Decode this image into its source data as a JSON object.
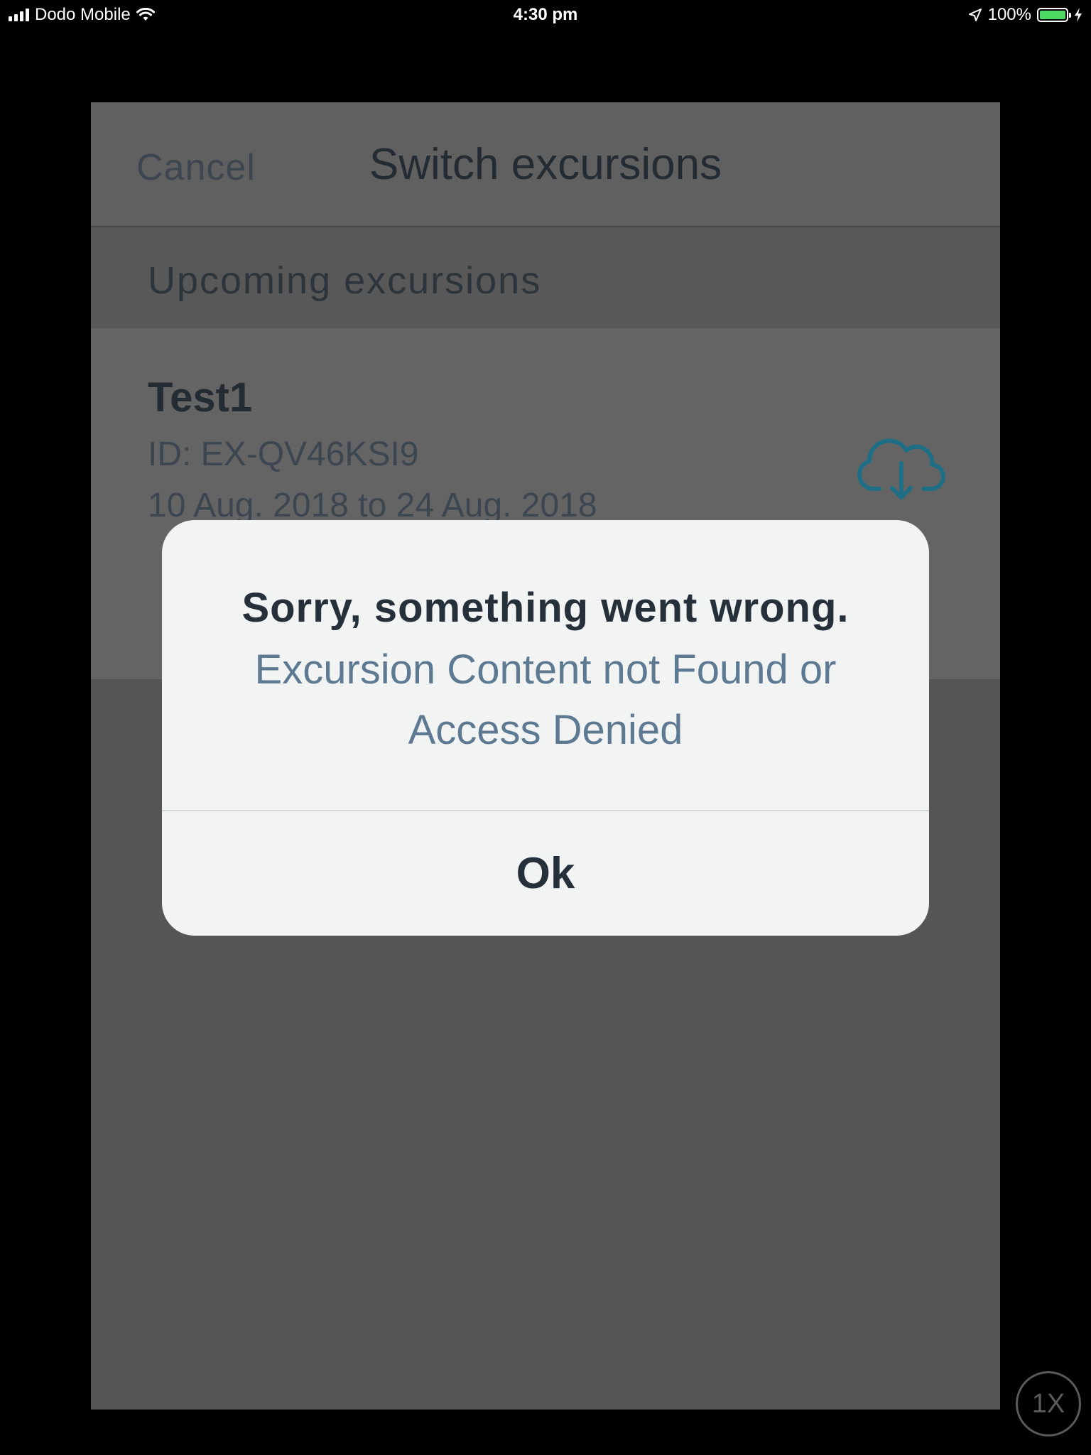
{
  "status_bar": {
    "carrier": "Dodo Mobile",
    "time": "4:30 pm",
    "battery": "100%",
    "battery_level": 1.0,
    "icons": [
      "signal-icon",
      "wifi-icon",
      "location-arrow-icon",
      "battery-icon",
      "charging-bolt-icon"
    ]
  },
  "nav": {
    "cancel_label": "Cancel",
    "title": "Switch excursions"
  },
  "section": {
    "header": "Upcoming excursions"
  },
  "excursion": {
    "name": "Test1",
    "id": "ID: EX-QV46KSI9",
    "dates": "10 Aug. 2018 to 24 Aug. 2018",
    "action_icon": "cloud-download-icon"
  },
  "alert": {
    "title": "Sorry, something went wrong.",
    "message": "Excursion Content not Found or Access Denied",
    "ok_label": "Ok"
  },
  "zoom_badge": "1X",
  "colors": {
    "accent": "#1e8fae",
    "alert_message": "#5d7a92",
    "battery": "#4cd964"
  }
}
